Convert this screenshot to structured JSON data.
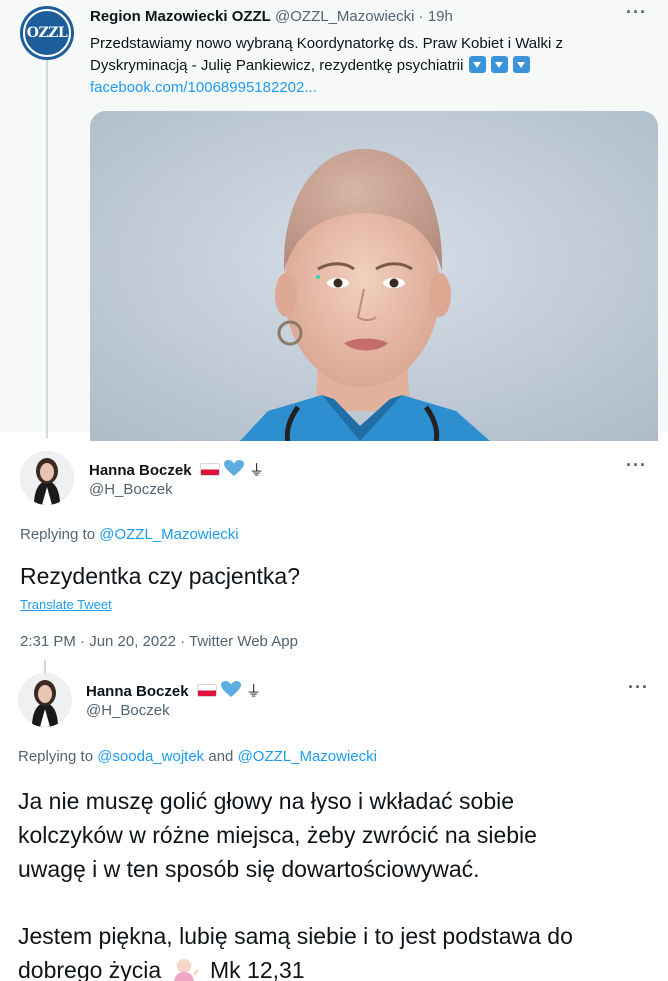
{
  "tweet_ozzl": {
    "name": "Region Mazowiecki OZZL",
    "handle": "@OZZL_Mazowiecki",
    "separator": "·",
    "time": "19h",
    "avatar_text": "OZZL",
    "text_line1": "Przedstawiamy nowo wybraną Koordynatorkę ds. Praw Kobiet i Walki z",
    "text_line2": "Dyskryminacją - Julię Pankiewicz, rezydentkę psychiatrii",
    "link": "facebook.com/10068995182202...",
    "more_icon": "more-dots-icon",
    "emoji_icon": "down-arrow-button-icon",
    "photo_icon": "portrait-photo"
  },
  "tweet_reply1": {
    "name": "Hanna Boczek",
    "handle": "@H_Boczek",
    "badges": [
      "poland-flag-icon",
      "blue-heart-icon",
      "ground-symbol"
    ],
    "ground_glyph": "⏚",
    "replying_prefix": "Replying to",
    "replying_to": "@OZZL_Mazowiecki",
    "body": "Rezydentka czy pacjentka?",
    "translate": "Translate Tweet",
    "meta": "2:31 PM · Jun 20, 2022 · Twitter Web App"
  },
  "tweet_reply2": {
    "name": "Hanna Boczek",
    "handle": "@H_Boczek",
    "ground_glyph": "⏚",
    "replying_prefix": "Replying to",
    "replying_to_1": "@sooda_wojtek",
    "replying_and": "and",
    "replying_to_2": "@OZZL_Mazowiecki",
    "p1_line1": "Ja nie muszę golić głowy na łyso i wkładać sobie",
    "p1_line2": "kolczyków w różne miejsca, żeby zwrócić na siebie",
    "p1_line3": "uwagę i w ten sposób się dowartościowywać.",
    "p2_line1": "Jestem piękna, lubię samą siebie i to jest podstawa do",
    "p2_line2_a": "dobrego życia",
    "p2_line2_b": "Mk 12,31"
  },
  "colors": {
    "link": "#1d9bf0",
    "muted": "#536471",
    "thread_line": "#cfd9de",
    "ozzl_blue": "#1d5d9b"
  }
}
